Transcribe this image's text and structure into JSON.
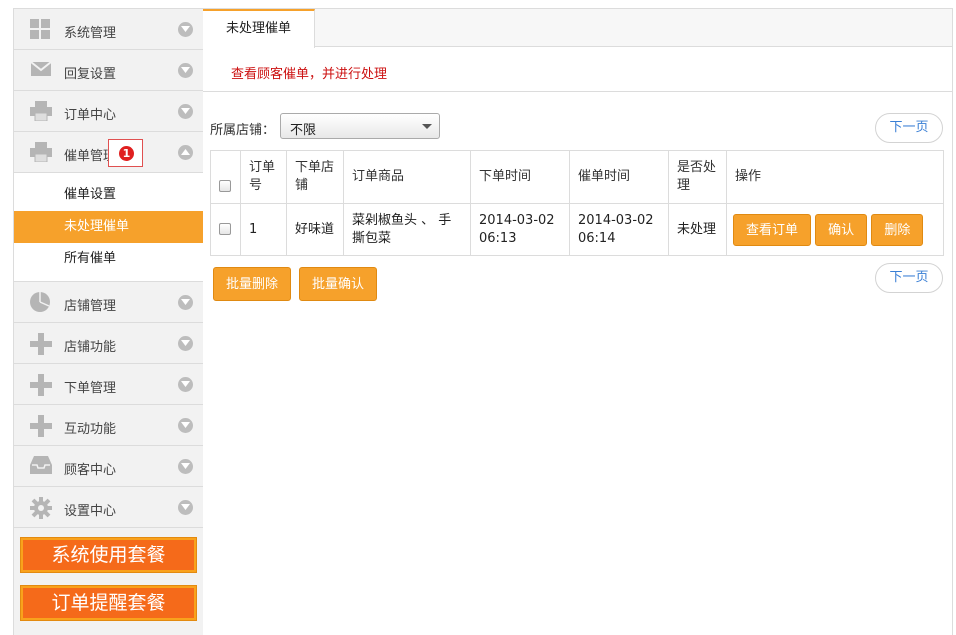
{
  "sidebar": {
    "items": [
      {
        "label": "系统管理",
        "icon": "grid-icon"
      },
      {
        "label": "回复设置",
        "icon": "envelope-icon"
      },
      {
        "label": "订单中心",
        "icon": "printer-icon"
      },
      {
        "label": "催单管理",
        "icon": "printer-icon"
      }
    ],
    "badge": "1",
    "submenu": [
      "催单设置",
      "未处理催单",
      "所有催单"
    ],
    "items_after": [
      {
        "label": "店铺管理",
        "icon": "pie-chart-icon"
      },
      {
        "label": "店铺功能",
        "icon": "plus-icon"
      },
      {
        "label": "下单管理",
        "icon": "plus-icon"
      },
      {
        "label": "互动功能",
        "icon": "plus-icon"
      },
      {
        "label": "顾客中心",
        "icon": "inbox-icon"
      },
      {
        "label": "设置中心",
        "icon": "gear-icon"
      }
    ],
    "promo1": "系统使用套餐",
    "promo2": "订单提醒套餐"
  },
  "main": {
    "tab": "未处理催单",
    "subtitle": "查看顾客催单，并进行处理",
    "filter_label": "所属店铺：",
    "filter_value": "不限",
    "next_page": "下一页",
    "table": {
      "headers": [
        "订单号",
        "下单店铺",
        "订单商品",
        "下单时间",
        "催单时间",
        "是否处理",
        "操作"
      ],
      "rows": [
        {
          "id": "1",
          "store": "好味道",
          "goods": "菜剁椒鱼头 、 手撕包菜",
          "order_time": "2014-03-02 06:13",
          "urge_time": "2014-03-02 06:14",
          "status": "未处理"
        }
      ],
      "actions": [
        "查看订单",
        "确认",
        "删除"
      ]
    },
    "batch_delete": "批量删除",
    "batch_confirm": "批量确认"
  },
  "colors": {
    "accent": "#f6a12b",
    "subtitle_red": "#cc1111",
    "link_blue": "#3a7fd5"
  }
}
